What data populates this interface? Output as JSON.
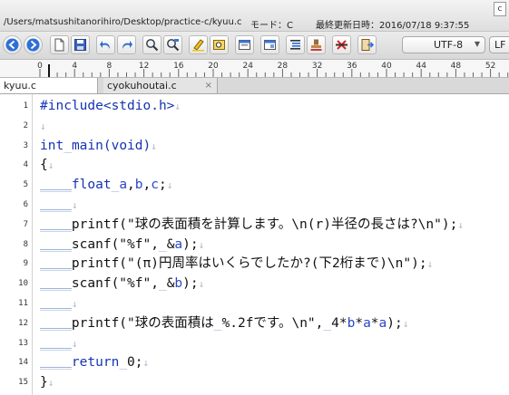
{
  "titlebar": {
    "file_path": "/Users/matsushitanorihiro/Desktop/practice-c/kyuu.c",
    "mode_label": "モード：C",
    "updated_label": "最終更新日時：2016/07/18 9:37:55",
    "corner_icon_text": "c"
  },
  "toolbar": {
    "encoding": "UTF-8",
    "line_ending": "LF",
    "buttons": [
      "back-icon",
      "forward-icon",
      "new-document-icon",
      "save-icon",
      "undo-icon",
      "redo-icon",
      "search-icon",
      "replace-icon",
      "highlight-icon",
      "find-in-files-icon",
      "open-icon",
      "window-icon",
      "indent-icon",
      "stamp-icon",
      "diff-icon",
      "exit-icon"
    ]
  },
  "ruler": {
    "labels": [
      "0",
      "4",
      "8",
      "12",
      "16",
      "20",
      "24",
      "28",
      "32",
      "36",
      "40",
      "44",
      "48",
      "52"
    ]
  },
  "tabs": [
    {
      "label": "kyuu.c",
      "active": true
    },
    {
      "label": "cyokuhoutai.c",
      "active": false,
      "close": "×"
    }
  ],
  "editor": {
    "newline_mark": "↓",
    "lines": [
      {
        "num": "1",
        "parts": [
          {
            "t": "#include<stdio.h>",
            "c": "kw"
          },
          {
            "t": "↓",
            "c": "nl"
          }
        ]
      },
      {
        "num": "2",
        "parts": [
          {
            "t": "↓",
            "c": "nl"
          }
        ]
      },
      {
        "num": "3",
        "parts": [
          {
            "t": "int",
            "c": "kw"
          },
          {
            "t": "_",
            "c": "sp"
          },
          {
            "t": "main(void)",
            "c": "kw"
          },
          {
            "t": "↓",
            "c": "nl"
          }
        ]
      },
      {
        "num": "4",
        "parts": [
          {
            "t": "{",
            "c": ""
          },
          {
            "t": "↓",
            "c": "nl"
          }
        ]
      },
      {
        "num": "5",
        "parts": [
          {
            "t": "____",
            "c": "indent"
          },
          {
            "t": "float",
            "c": "kw"
          },
          {
            "t": "_",
            "c": "sp"
          },
          {
            "t": "a",
            "c": "var"
          },
          {
            "t": ",",
            "c": ""
          },
          {
            "t": "b",
            "c": "var"
          },
          {
            "t": ",",
            "c": ""
          },
          {
            "t": "c",
            "c": "var"
          },
          {
            "t": ";",
            "c": ""
          },
          {
            "t": "↓",
            "c": "nl"
          }
        ]
      },
      {
        "num": "6",
        "parts": [
          {
            "t": "____",
            "c": "indent"
          },
          {
            "t": "↓",
            "c": "nl"
          }
        ]
      },
      {
        "num": "7",
        "parts": [
          {
            "t": "____",
            "c": "indent"
          },
          {
            "t": "printf(\"球の表面積を計算します。\\n(r)半径の長さは?\\n\");",
            "c": ""
          },
          {
            "t": "↓",
            "c": "nl"
          }
        ]
      },
      {
        "num": "8",
        "parts": [
          {
            "t": "____",
            "c": "indent"
          },
          {
            "t": "scanf(\"%f\",",
            "c": ""
          },
          {
            "t": "_",
            "c": "sp"
          },
          {
            "t": "&",
            "c": ""
          },
          {
            "t": "a",
            "c": "var"
          },
          {
            "t": ");",
            "c": ""
          },
          {
            "t": "↓",
            "c": "nl"
          }
        ]
      },
      {
        "num": "9",
        "parts": [
          {
            "t": "____",
            "c": "indent"
          },
          {
            "t": "printf(\"(π)円周率はいくらでしたか?(下2桁まで)\\n\");",
            "c": ""
          },
          {
            "t": "↓",
            "c": "nl"
          }
        ]
      },
      {
        "num": "10",
        "parts": [
          {
            "t": "____",
            "c": "indent"
          },
          {
            "t": "scanf(\"%f\",",
            "c": ""
          },
          {
            "t": "_",
            "c": "sp"
          },
          {
            "t": "&",
            "c": ""
          },
          {
            "t": "b",
            "c": "var"
          },
          {
            "t": ");",
            "c": ""
          },
          {
            "t": "↓",
            "c": "nl"
          }
        ]
      },
      {
        "num": "11",
        "parts": [
          {
            "t": "____",
            "c": "indent"
          },
          {
            "t": "↓",
            "c": "nl"
          }
        ]
      },
      {
        "num": "12",
        "parts": [
          {
            "t": "____",
            "c": "indent"
          },
          {
            "t": "printf(\"球の表面積は",
            "c": ""
          },
          {
            "t": "_",
            "c": "sp"
          },
          {
            "t": "%.2fです。\\n\",",
            "c": ""
          },
          {
            "t": "_",
            "c": "sp"
          },
          {
            "t": "4*",
            "c": ""
          },
          {
            "t": "b",
            "c": "var"
          },
          {
            "t": "*",
            "c": ""
          },
          {
            "t": "a",
            "c": "var"
          },
          {
            "t": "*",
            "c": ""
          },
          {
            "t": "a",
            "c": "var"
          },
          {
            "t": ");",
            "c": ""
          },
          {
            "t": "↓",
            "c": "nl"
          }
        ]
      },
      {
        "num": "13",
        "parts": [
          {
            "t": "____",
            "c": "indent"
          },
          {
            "t": "↓",
            "c": "nl"
          }
        ]
      },
      {
        "num": "14",
        "parts": [
          {
            "t": "____",
            "c": "indent"
          },
          {
            "t": "return",
            "c": "kw"
          },
          {
            "t": "_",
            "c": "sp"
          },
          {
            "t": "0;",
            "c": ""
          },
          {
            "t": "↓",
            "c": "nl"
          }
        ]
      },
      {
        "num": "15",
        "parts": [
          {
            "t": "}",
            "c": ""
          },
          {
            "t": "↓",
            "c": "nl"
          }
        ]
      }
    ]
  }
}
